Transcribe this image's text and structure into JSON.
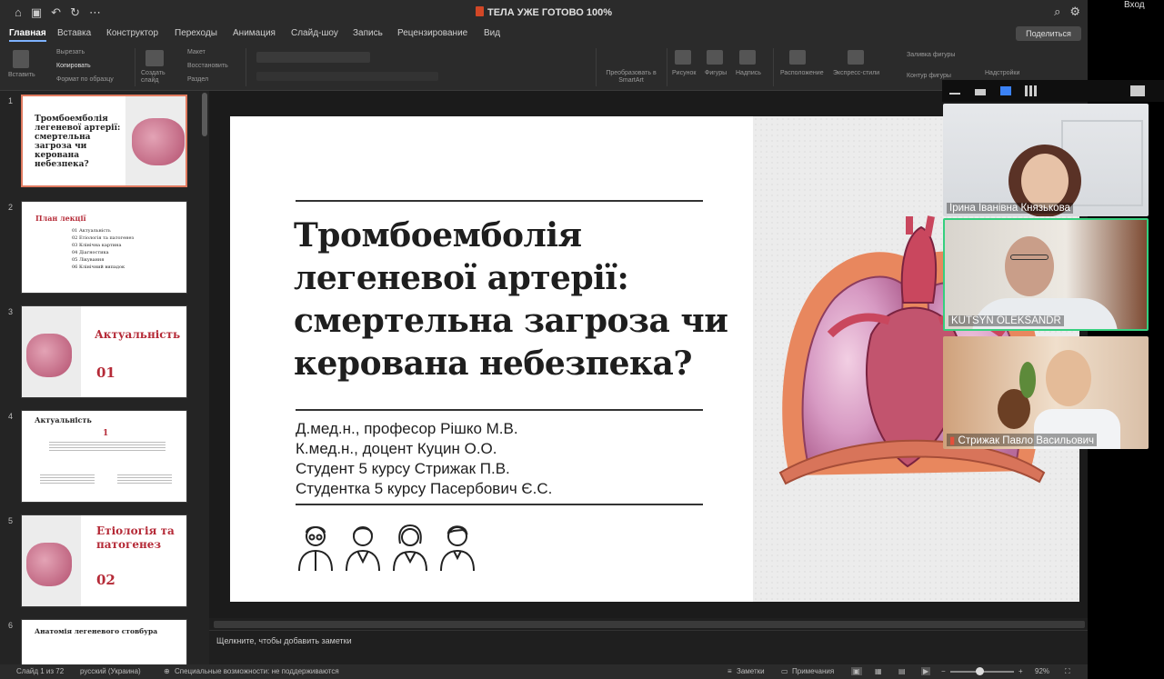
{
  "app": {
    "doc_title": "ТЕЛА УЖЕ ГОТОВО 100%",
    "share_label": "Поделиться",
    "tabs": [
      "Главная",
      "Вставка",
      "Конструктор",
      "Переходы",
      "Анимация",
      "Слайд-шоу",
      "Запись",
      "Рецензирование",
      "Вид"
    ]
  },
  "ribbon": {
    "paste": "Вставить",
    "cut": "Вырезать",
    "copy": "Копировать",
    "format": "Формат по образцу",
    "new_slide": "Создать слайд",
    "layout": "Макет",
    "reset": "Восстановить",
    "section": "Раздел",
    "smartart": "Преобразовать в SmartArt",
    "picture": "Рисунок",
    "shapes": "Фигуры",
    "textbox": "Надпись",
    "arrange": "Расположение",
    "quick_styles": "Экспресс-стили",
    "fill": "Заливка фигуры",
    "outline": "Контур фигуры",
    "addins": "Надстройки"
  },
  "thumbnails": [
    {
      "num": "1",
      "title": "Тромбоемболія легеневої артерії: смертельна загроза чи керована небезпека?"
    },
    {
      "num": "2",
      "title": "План лекції",
      "items": [
        "01 Актуальність",
        "02 Етіологія та патогенез",
        "03 Клінічна картина",
        "04 Діагностика",
        "05 Лікування",
        "06 Клінічний випадок"
      ]
    },
    {
      "num": "3",
      "title": "Актуальність",
      "sub": "01"
    },
    {
      "num": "4",
      "title": "Актуальність",
      "sub": "1"
    },
    {
      "num": "5",
      "title": "Етіологія та патогенез",
      "sub": "02"
    },
    {
      "num": "6",
      "title": "Анатомія легеневого стовбура"
    }
  ],
  "slide": {
    "title_lines": [
      "Тромбоемболія",
      "легеневої артерії:",
      "смертельна загроза чи",
      "керована небезпека?"
    ],
    "authors": [
      "Д.мед.н., професор Рішко М.В.",
      "К.мед.н., доцент Куцин О.О.",
      "Студент 5 курсу Стрижак П.В.",
      "Студентка 5 курсу Пасербович Є.С."
    ]
  },
  "notes_placeholder": "Щелкните, чтобы добавить заметки",
  "status": {
    "slide_count": "Слайд 1 из 72",
    "language": "русский (Украина)",
    "accessibility": "Специальные возможности: не поддерживаются",
    "notes": "Заметки",
    "comments": "Примечания",
    "zoom": "92%"
  },
  "video": {
    "top_label": "Вход",
    "participants": [
      {
        "name": "Ірина Іванівна Князькова"
      },
      {
        "name": "KUTSYN OLEKSANDR"
      },
      {
        "name": "Стрижак Павло Васильович"
      }
    ]
  },
  "colors": {
    "accent": "#b52a37",
    "active_speaker": "#35d07f",
    "tab_underline": "#7eb2ff"
  }
}
